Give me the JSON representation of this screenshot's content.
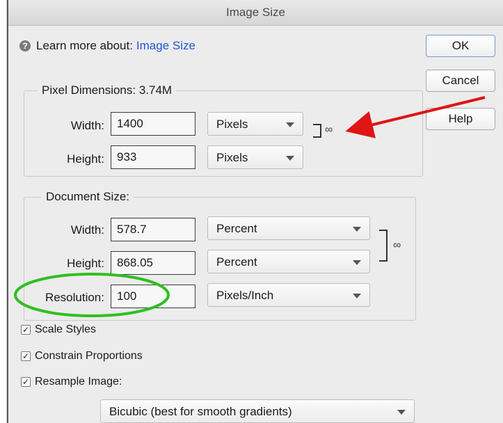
{
  "window": {
    "title": "Image Size"
  },
  "help": {
    "prefix": "Learn more about:",
    "link": "Image Size"
  },
  "buttons": {
    "ok": "OK",
    "cancel": "Cancel",
    "help": "Help"
  },
  "pixel_dimensions": {
    "title": "Pixel Dimensions:  3.74M",
    "width_label": "Width:",
    "width_value": "1400",
    "width_unit": "Pixels",
    "height_label": "Height:",
    "height_value": "933",
    "height_unit": "Pixels"
  },
  "document_size": {
    "title": "Document Size:",
    "width_label": "Width:",
    "width_value": "578.7",
    "width_unit": "Percent",
    "height_label": "Height:",
    "height_value": "868.05",
    "height_unit": "Percent",
    "resolution_label": "Resolution:",
    "resolution_value": "100",
    "resolution_unit": "Pixels/Inch"
  },
  "options": {
    "scale_styles": {
      "label": "Scale Styles",
      "checked": true
    },
    "constrain_proportions": {
      "label": "Constrain Proportions",
      "checked": true
    },
    "resample_image": {
      "label": "Resample Image:",
      "checked": true
    },
    "resample_method": "Bicubic (best for smooth gradients)"
  },
  "colors": {
    "link": "#2157d6",
    "arrow": "#e01515",
    "circle": "#2ec01f"
  },
  "icons": {
    "help": "question-circle-icon",
    "link": "chain-link-icon",
    "check": "check-icon",
    "dropdown": "triangle-down-icon"
  }
}
